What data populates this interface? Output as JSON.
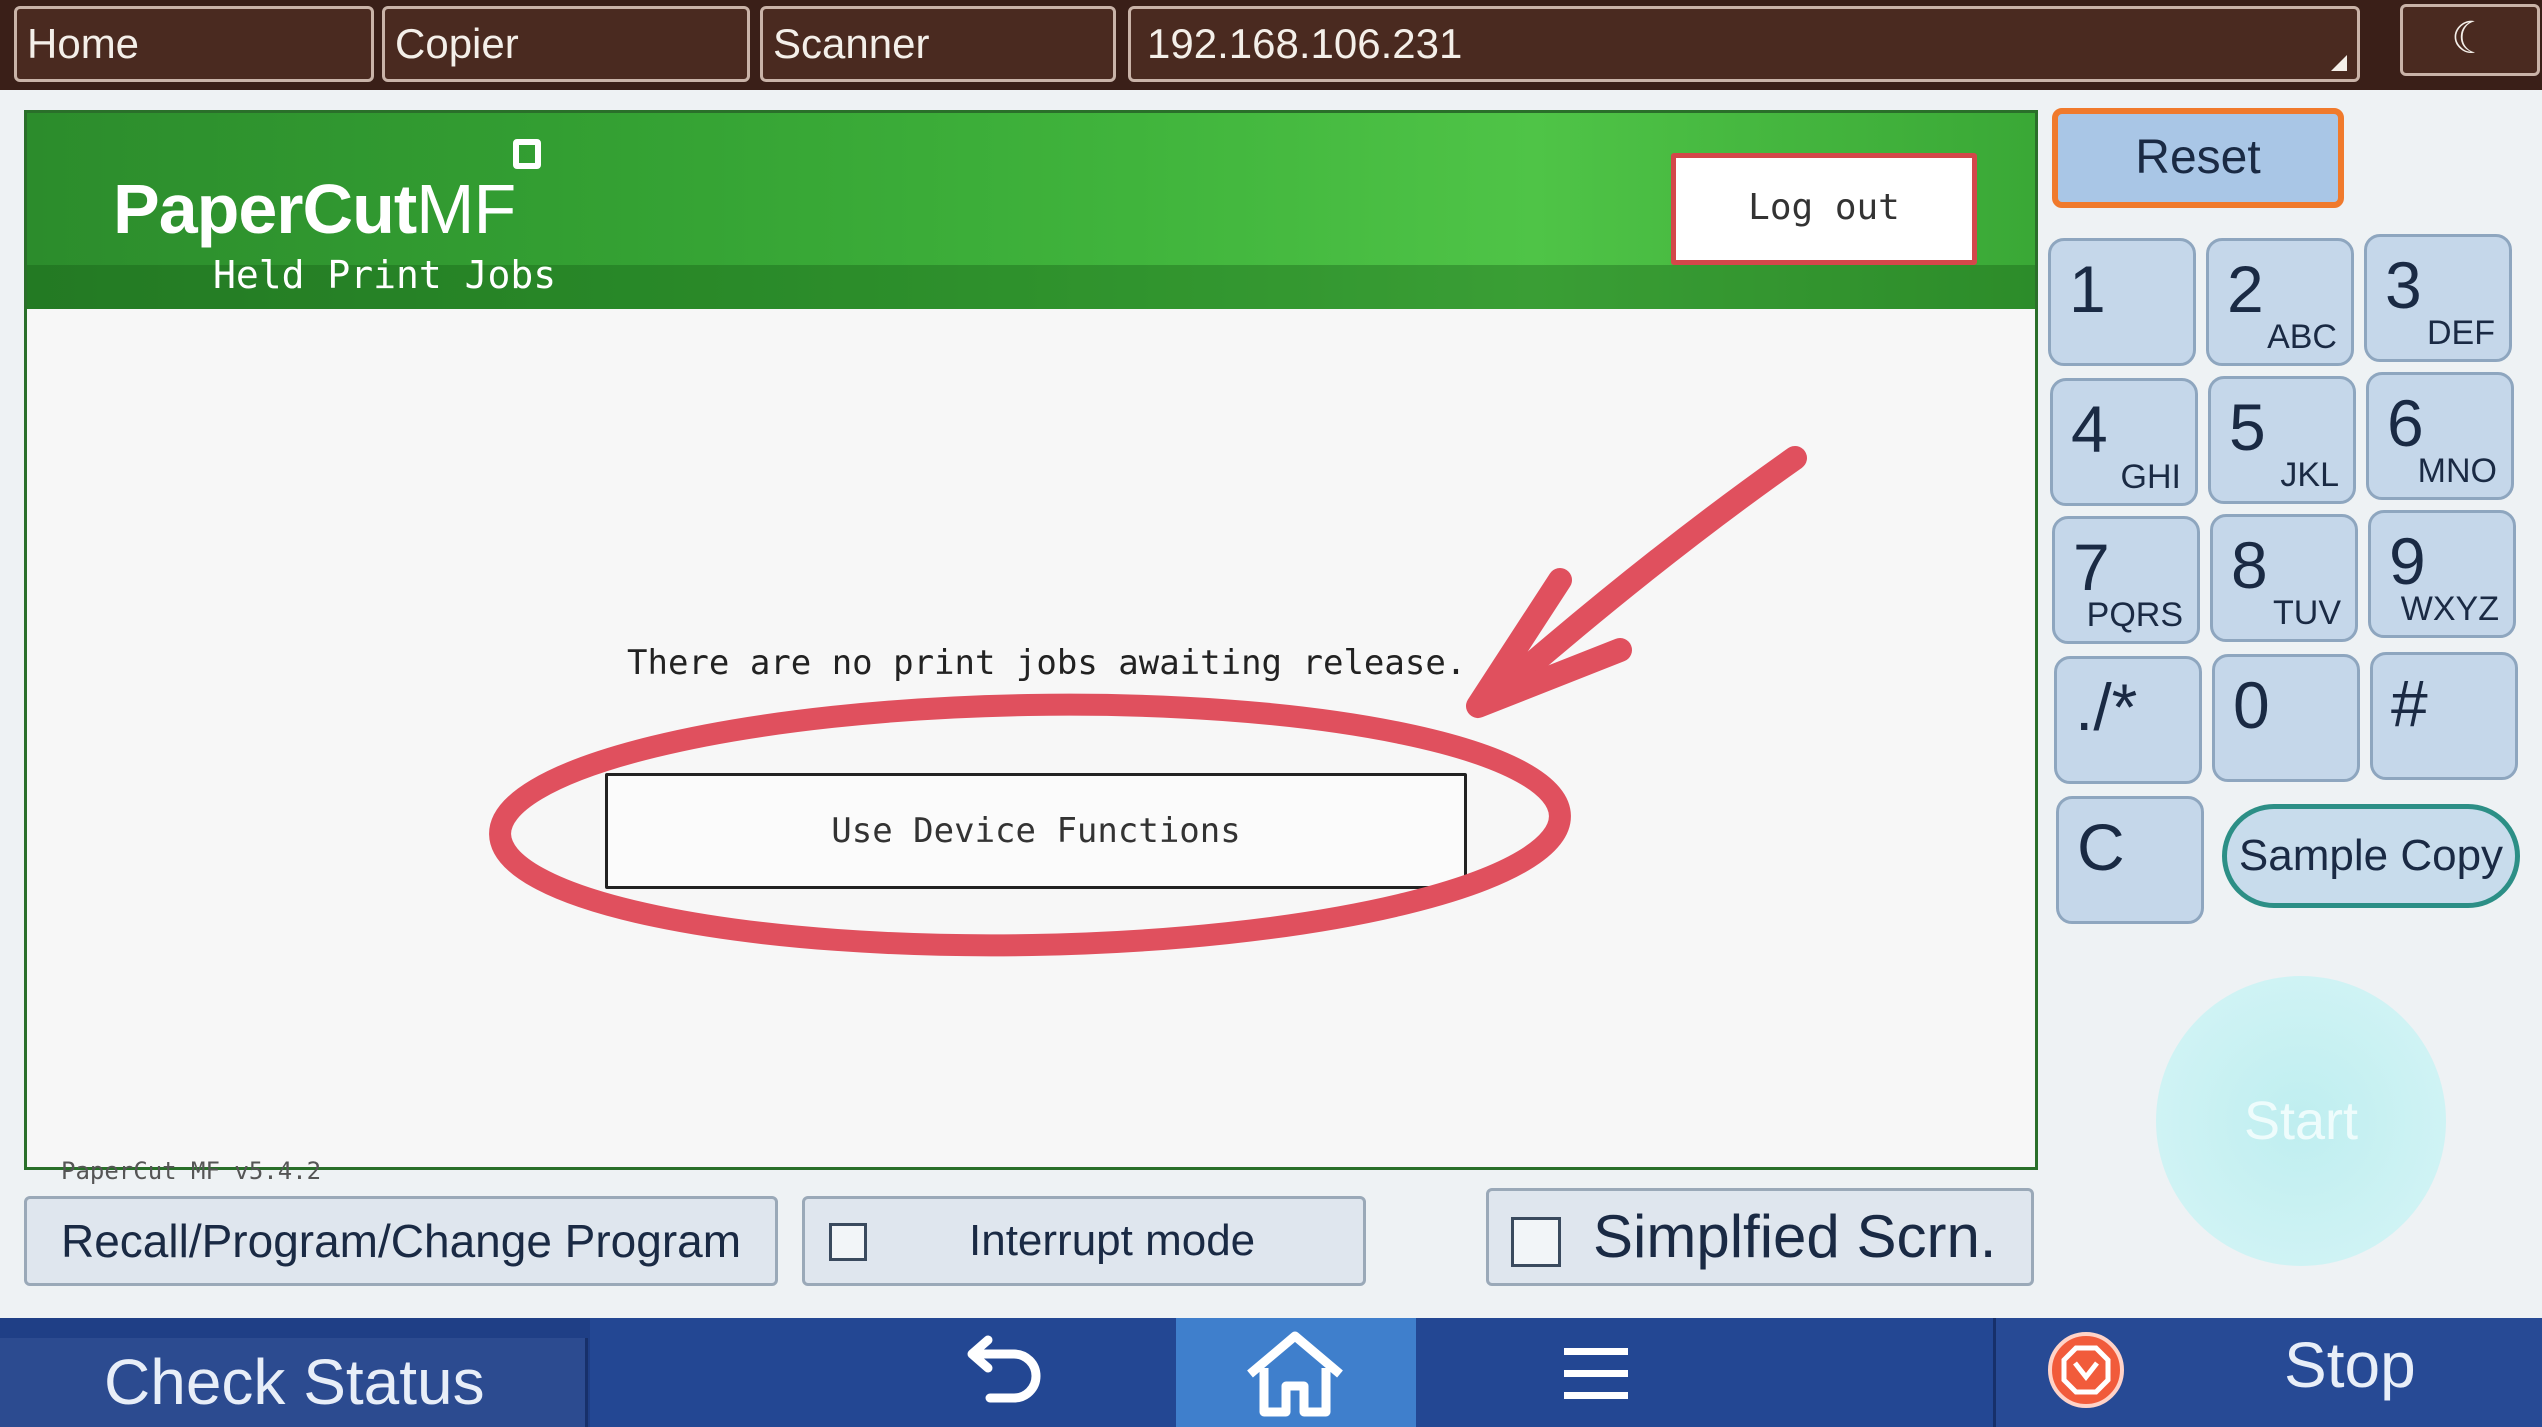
{
  "top_tabs": {
    "home": "Home",
    "copier": "Copier",
    "scanner": "Scanner",
    "address": "192.168.106.231"
  },
  "papercut": {
    "logo": "PaperCut",
    "logo_suffix": "MF",
    "subtitle": "Held Print Jobs",
    "logout_label": "Log out",
    "message": "There are no print jobs awaiting release.",
    "use_device_label": "Use Device Functions",
    "version": "PaperCut MF v5.4.2"
  },
  "keypad": {
    "reset_label": "Reset",
    "keys": [
      {
        "num": "1",
        "letters": ""
      },
      {
        "num": "2",
        "letters": "ABC"
      },
      {
        "num": "3",
        "letters": "DEF"
      },
      {
        "num": "4",
        "letters": "GHI"
      },
      {
        "num": "5",
        "letters": "JKL"
      },
      {
        "num": "6",
        "letters": "MNO"
      },
      {
        "num": "7",
        "letters": "PQRS"
      },
      {
        "num": "8",
        "letters": "TUV"
      },
      {
        "num": "9",
        "letters": "WXYZ"
      },
      {
        "num": "./*",
        "letters": ""
      },
      {
        "num": "0",
        "letters": ""
      },
      {
        "num": "#",
        "letters": ""
      },
      {
        "num": "C",
        "letters": ""
      }
    ],
    "sample_copy_label": "Sample Copy",
    "start_label": "Start"
  },
  "lower": {
    "recall_label": "Recall/Program/Change Program",
    "interrupt_label": "Interrupt mode",
    "simplified_label": "Simplfied Scrn."
  },
  "bottom": {
    "check_status_label": "Check Status",
    "stop_label": "Stop"
  },
  "colors": {
    "annotation": "#e0505e",
    "banner_green": "#34a133",
    "bottom_bar": "#1f3f86"
  }
}
